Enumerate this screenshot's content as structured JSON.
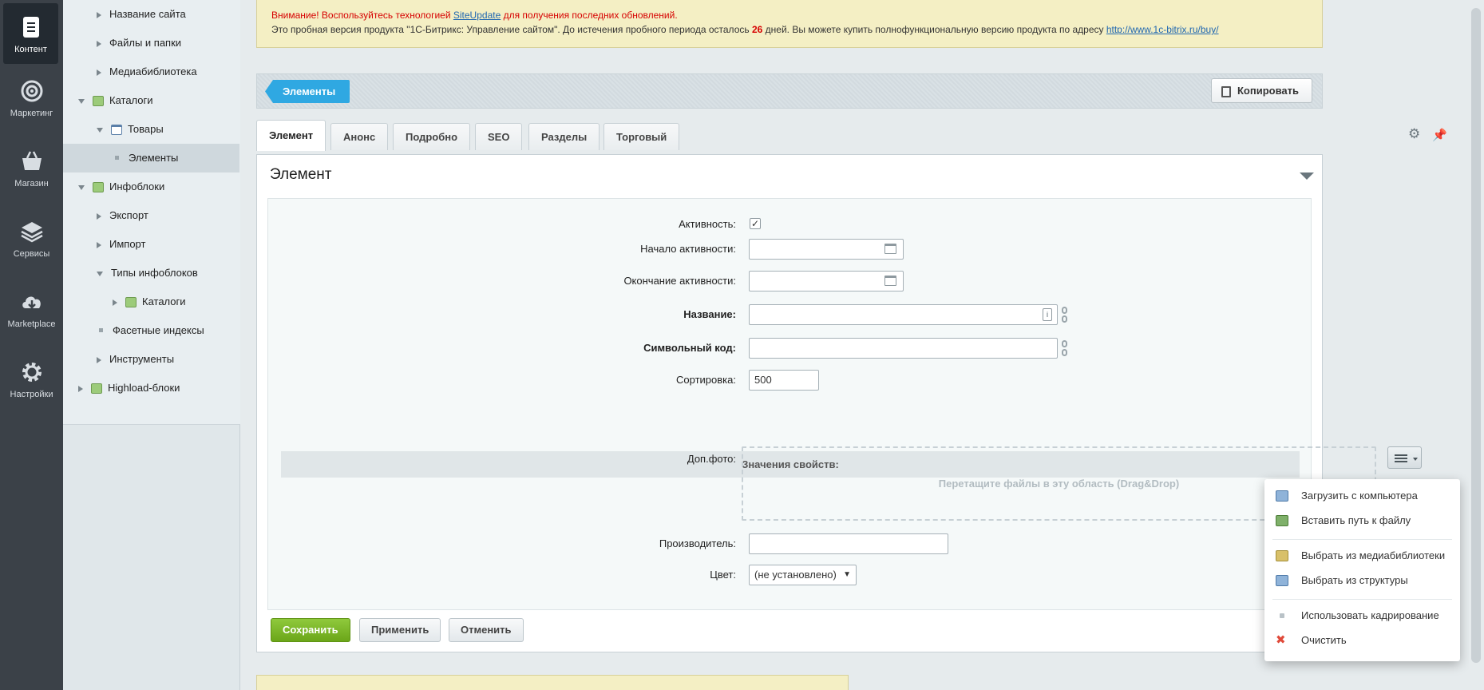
{
  "leftbar": {
    "items": [
      {
        "label": "Контент",
        "icon": "document-icon"
      },
      {
        "label": "Маркетинг",
        "icon": "target-icon"
      },
      {
        "label": "Магазин",
        "icon": "basket-icon"
      },
      {
        "label": "Сервисы",
        "icon": "layers-icon"
      },
      {
        "label": "Marketplace",
        "icon": "cloud-download-icon"
      },
      {
        "label": "Настройки",
        "icon": "gear-icon"
      }
    ]
  },
  "tree": {
    "items": [
      {
        "label": "Название сайта"
      },
      {
        "label": "Файлы и папки"
      },
      {
        "label": "Медиабиблиотека"
      },
      {
        "label": "Каталоги"
      },
      {
        "label": "Товары"
      },
      {
        "label": "Элементы"
      },
      {
        "label": "Инфоблоки"
      },
      {
        "label": "Экспорт"
      },
      {
        "label": "Импорт"
      },
      {
        "label": "Типы инфоблоков"
      },
      {
        "label": "Каталоги"
      },
      {
        "label": "Фасетные индексы"
      },
      {
        "label": "Инструменты"
      },
      {
        "label": "Highload-блоки"
      }
    ]
  },
  "notice": {
    "line1_prefix": "Внимание! Воспользуйтесь технологией ",
    "line1_link": "SiteUpdate",
    "line1_suffix": " для получения последних обновлений.",
    "line2_prefix": "Это пробная версия продукта \"1С-Битрикс: Управление сайтом\". До истечения пробного периода осталось ",
    "days": "26",
    "line2_middle": " дней. Вы можете купить полнофункциональную версию продукта по адресу ",
    "line2_link": "http://www.1c-bitrix.ru/buy/"
  },
  "toolbar": {
    "elements_button": "Элементы",
    "copy_button": "Копировать"
  },
  "tabs": [
    "Элемент",
    "Анонс",
    "Подробно",
    "SEO",
    "Разделы",
    "Торговый каталог"
  ],
  "panel": {
    "title": "Элемент"
  },
  "form": {
    "active_label": "Активность:",
    "active_checked": "✓",
    "start_label": "Начало активности:",
    "end_label": "Окончание активности:",
    "name_label": "Название:",
    "code_label": "Символьный код:",
    "sort_label": "Сортировка:",
    "sort_value": "500",
    "props_header": "Значения свойств:",
    "photo_label": "Доп.фото:",
    "dropzone_text": "Перетащите файлы в эту область (Drag&Drop)",
    "manufacturer_label": "Производитель:",
    "color_label": "Цвет:",
    "color_value": "(не установлено)"
  },
  "buttons": {
    "save": "Сохранить",
    "apply": "Применить",
    "cancel": "Отменить"
  },
  "popup": {
    "items": [
      {
        "label": "Загрузить с компьютера",
        "icon": "upload-computer-icon"
      },
      {
        "label": "Вставить путь к файлу",
        "icon": "insert-path-icon"
      },
      {
        "label": "Выбрать из медиабиблиотеки",
        "icon": "medialib-icon"
      },
      {
        "label": "Выбрать из структуры",
        "icon": "structure-icon"
      },
      {
        "label": "Использовать кадрирование",
        "icon": "crop-icon"
      },
      {
        "label": "Очистить",
        "icon": "clear-icon"
      }
    ]
  },
  "colors": {
    "accent_blue": "#2fa8e2",
    "save_green": "#6ba619",
    "warning_red": "#d60000",
    "leftbar": "#3b4148"
  }
}
